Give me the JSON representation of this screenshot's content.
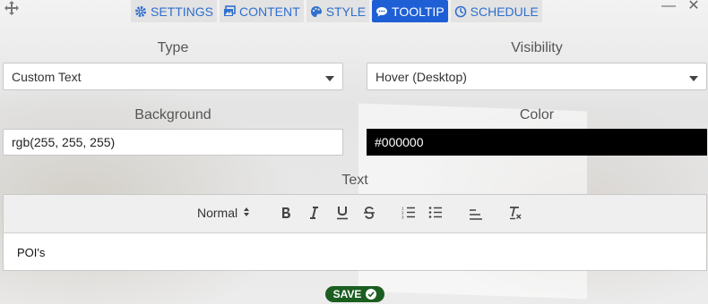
{
  "tabs": [
    {
      "label": "SETTINGS",
      "icon": "gear-icon"
    },
    {
      "label": "CONTENT",
      "icon": "images-icon"
    },
    {
      "label": "STYLE",
      "icon": "palette-icon"
    },
    {
      "label": "TOOLTIP",
      "icon": "comment-icon",
      "active": true
    },
    {
      "label": "SCHEDULE",
      "icon": "clock-icon"
    }
  ],
  "window": {
    "minimize": "—",
    "close": "✕"
  },
  "form": {
    "type_label": "Type",
    "type_value": "Custom Text",
    "visibility_label": "Visibility",
    "visibility_value": "Hover (Desktop)",
    "background_label": "Background",
    "background_value": "rgb(255, 255, 255)",
    "color_label": "Color",
    "color_value": "#000000",
    "text_label": "Text"
  },
  "editor": {
    "format": "Normal",
    "content": "POI's"
  },
  "save_label": "SAVE",
  "colors": {
    "accent": "#1f5fd6",
    "tab_text": "#2f6fcf",
    "save": "#1b5e20"
  }
}
